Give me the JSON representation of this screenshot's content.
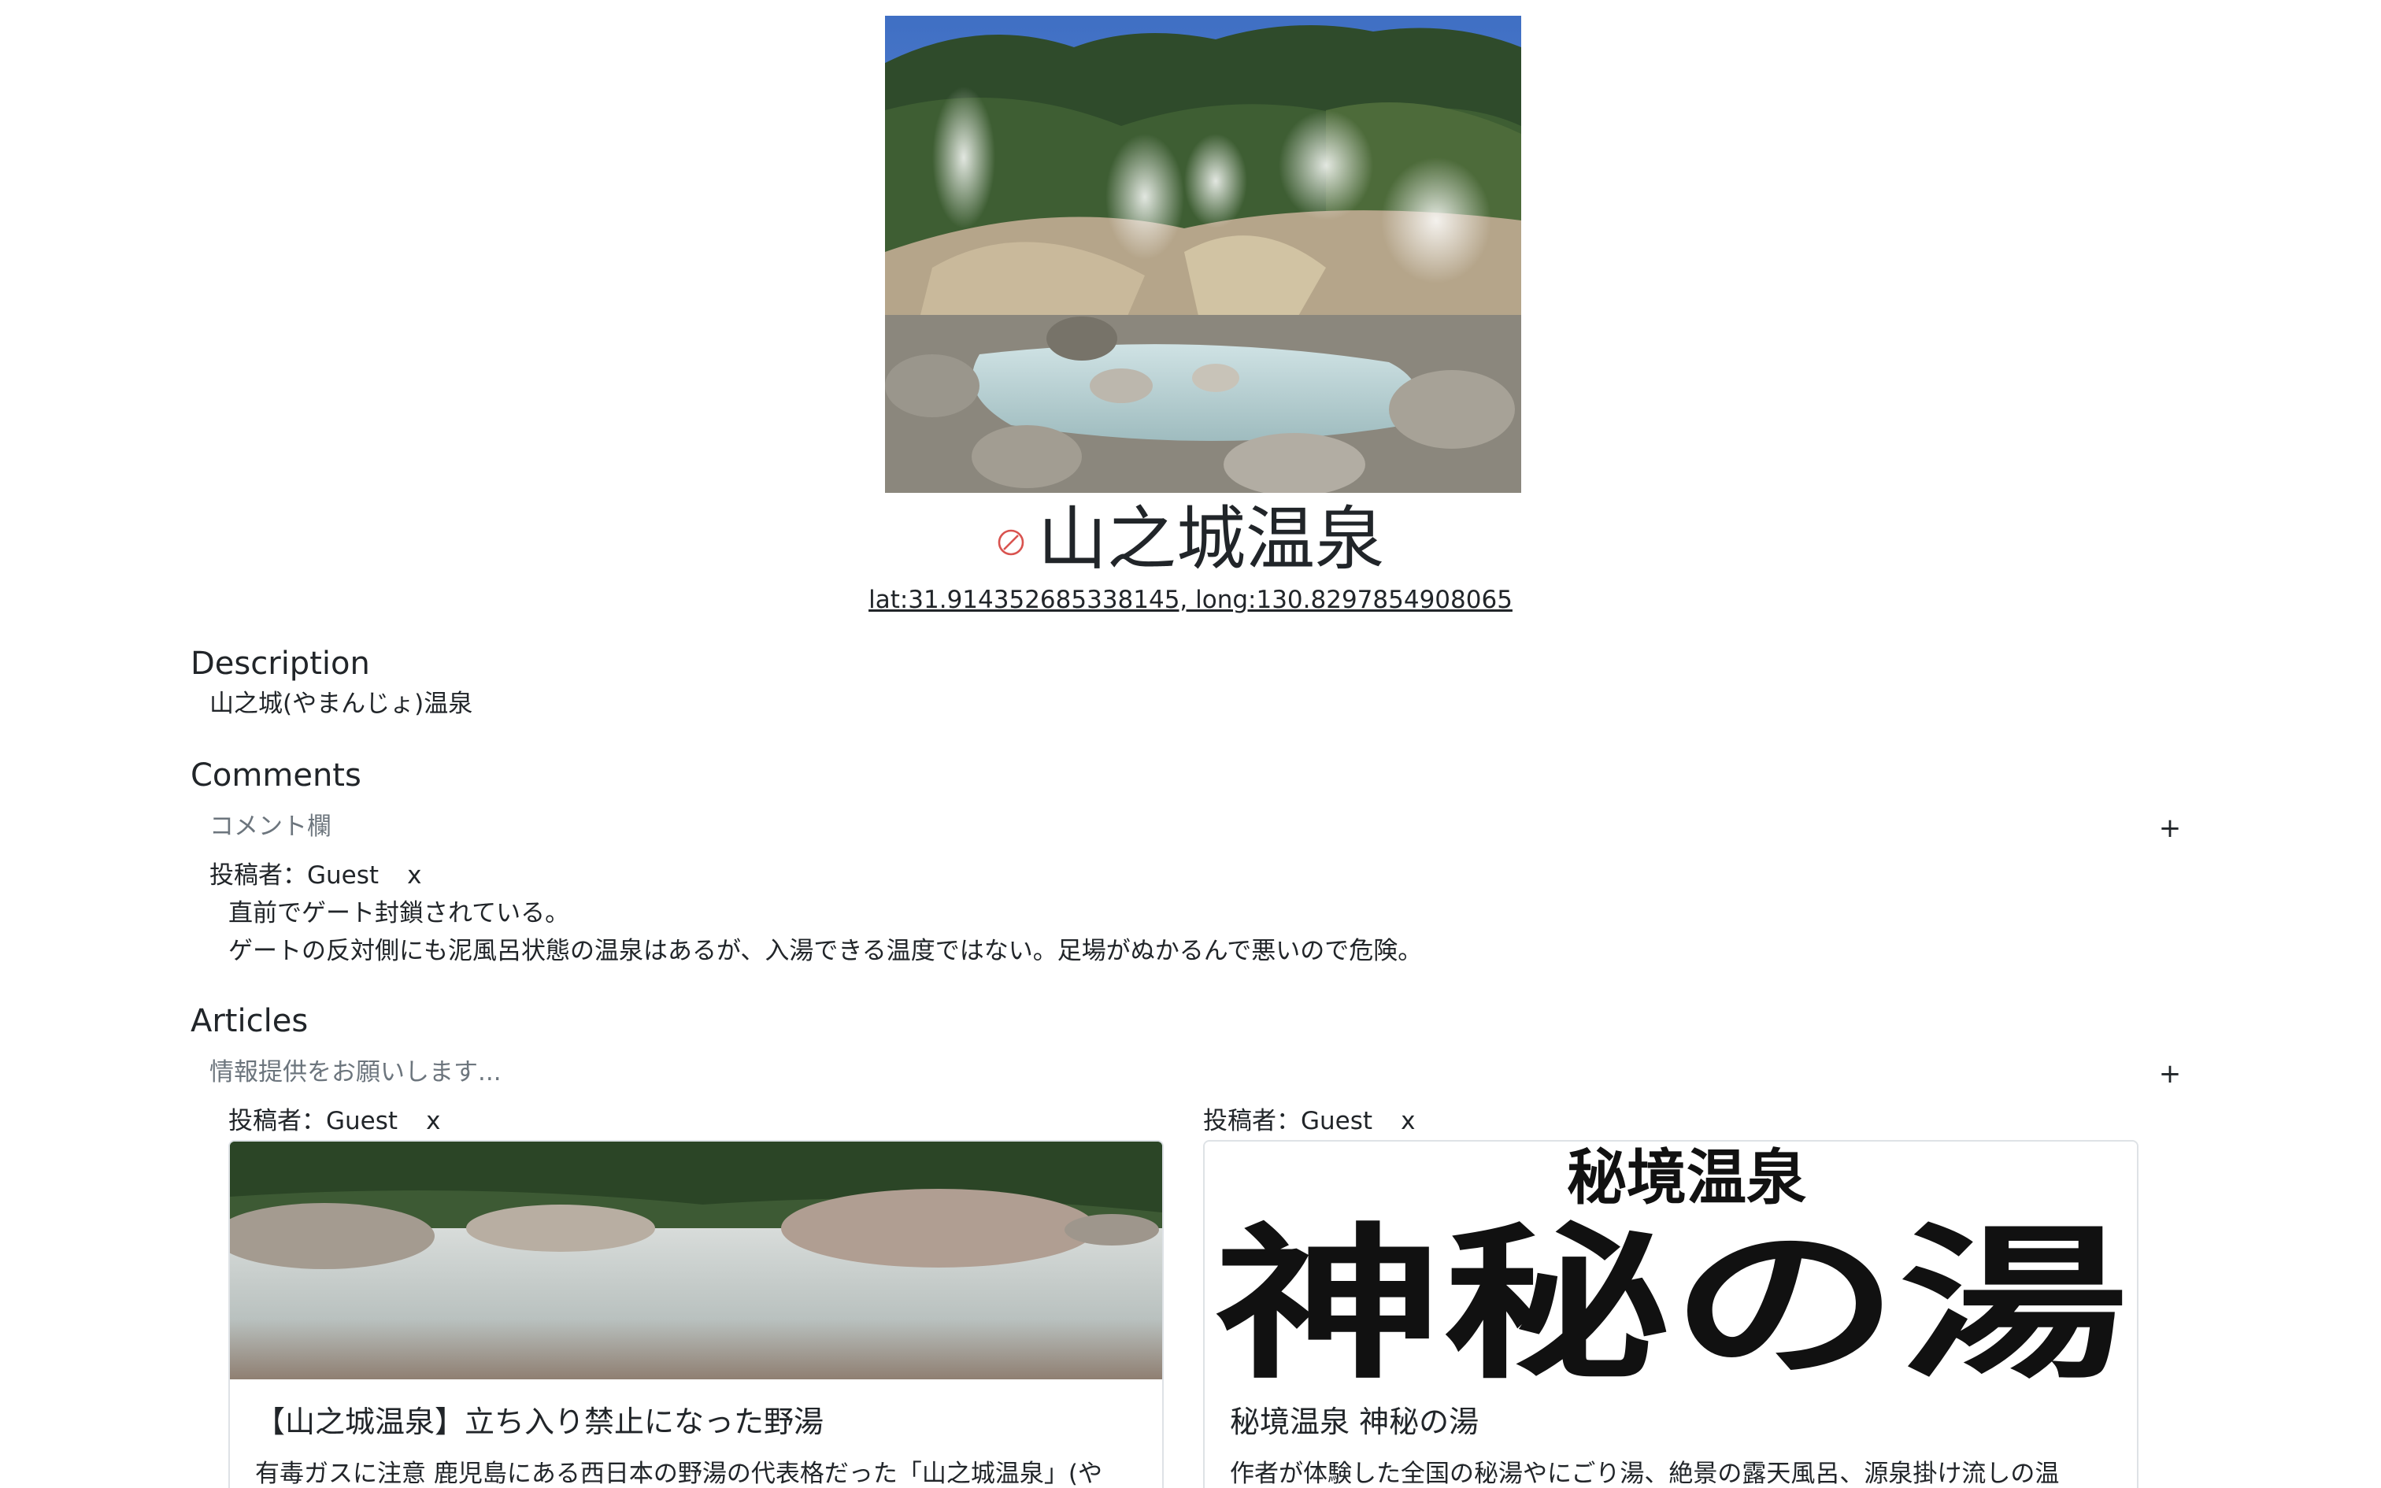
{
  "spot": {
    "name": "山之城温泉",
    "coordinates_link": "lat:31.914352685338145, long:130.8297854908065",
    "status_icon": "prohibited-icon",
    "status_color": "#d9534f"
  },
  "description": {
    "heading": "Description",
    "text": "山之城(やまんじょ)温泉"
  },
  "comments": {
    "heading": "Comments",
    "input_placeholder": "コメント欄",
    "add_label": "+",
    "items": [
      {
        "author": "投稿者：Guest",
        "delete_label": "x",
        "lines": [
          "直前でゲート封鎖されている。",
          "ゲートの反対側にも泥風呂状態の温泉はあるが、入湯できる温度ではない。足場がぬかるんで悪いので危険。"
        ]
      }
    ]
  },
  "articles": {
    "heading": "Articles",
    "input_placeholder": "情報提供をお願いします...",
    "add_label": "+",
    "items": [
      {
        "author": "投稿者：Guest",
        "delete_label": "x",
        "title": "【山之城温泉】立ち入り禁止になった野湯",
        "excerpt": "有毒ガスに注意 鹿児島にある西日本の野湯の代表格だった「山之城温泉」(や"
      },
      {
        "author": "投稿者：Guest",
        "delete_label": "x",
        "image_text_top": "秘境温泉",
        "image_text_main": "神秘の湯",
        "title": "秘境温泉 神秘の湯",
        "excerpt": "作者が体験した全国の秘湯やにごり湯、絶景の露天風呂、源泉掛け流しの温"
      }
    ]
  }
}
